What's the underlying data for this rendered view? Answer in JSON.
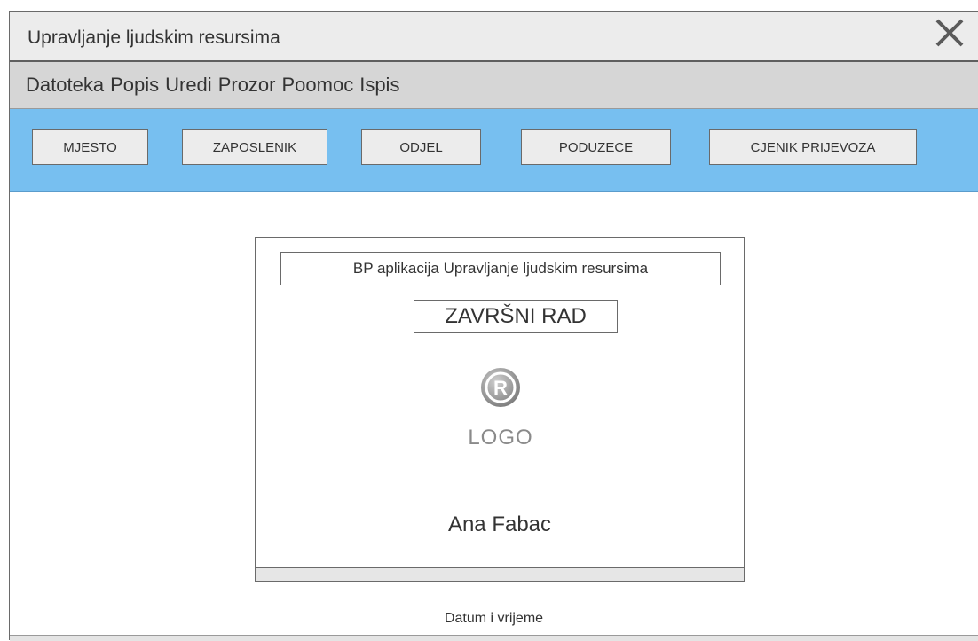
{
  "window": {
    "title": "Upravljanje ljudskim resursima",
    "close_icon": "close-icon"
  },
  "menu": {
    "items": [
      "Datoteka",
      "Popis",
      "Uredi",
      "Prozor",
      "Poomoc",
      "Ispis"
    ]
  },
  "toolbar": {
    "buttons": [
      "MJESTO",
      "ZAPOSLENIK",
      "ODJEL",
      "PODUZECE",
      "CJENIK PRIJEVOZA"
    ]
  },
  "splash": {
    "app_title": "BP aplikacija Upravljanje ljudskim resursima",
    "thesis_label": "ZAVRŠNI RAD",
    "logo_text": "LOGO",
    "logo_icon": "registered-trademark-icon",
    "author": "Ana Fabac"
  },
  "footer": {
    "datetime_label": "Datum i vrijeme"
  },
  "colors": {
    "toolbar_bg": "#77bff0",
    "titlebar_bg": "#ececec",
    "menubar_bg": "#d6d6d6"
  }
}
